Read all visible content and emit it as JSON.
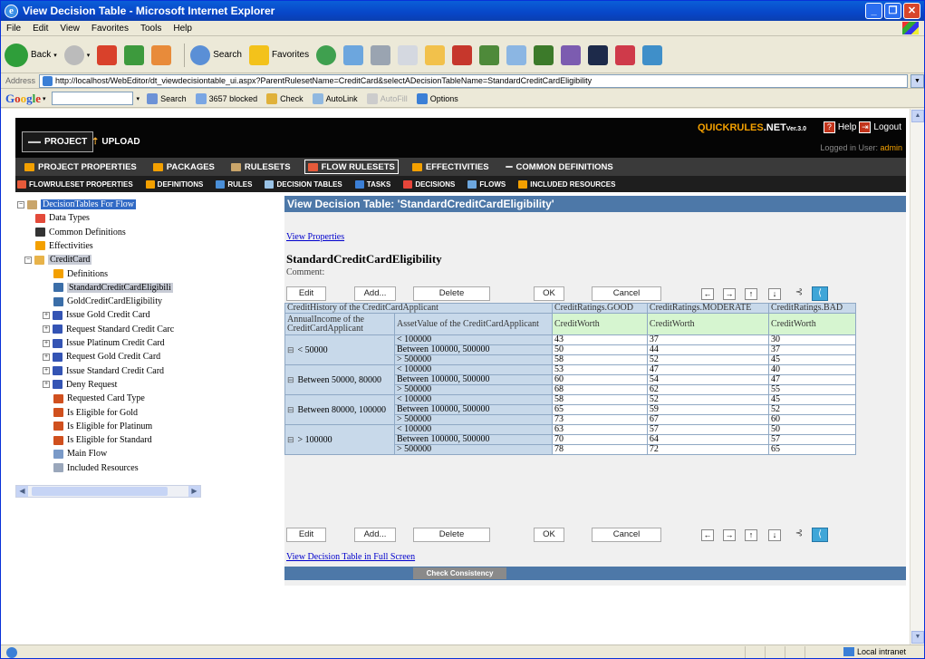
{
  "window": {
    "title": "View Decision Table - Microsoft Internet Explorer"
  },
  "menu": [
    "File",
    "Edit",
    "View",
    "Favorites",
    "Tools",
    "Help"
  ],
  "toolbar": {
    "back": "Back",
    "search": "Search",
    "favorites": "Favorites"
  },
  "address": {
    "label": "Address",
    "url": "http://localhost/WebEditor/dt_viewdecisiontable_ui.aspx?ParentRulesetName=CreditCard&selectADecisionTableName=StandardCreditCardEligibility"
  },
  "google": {
    "logo": "Google",
    "search": "Search",
    "blocked": "3657 blocked",
    "check": "Check",
    "autolink": "AutoLink",
    "autofill": "AutoFill",
    "options": "Options"
  },
  "status": {
    "zone": "Local intranet"
  },
  "app": {
    "project": "PROJECT",
    "upload": "UPLOAD",
    "brand": {
      "quick": "QUICKRULES",
      "net": ".NET",
      "ver": "Ver.3.0"
    },
    "help": "Help",
    "logout": "Logout",
    "logged_in": "Logged in User:",
    "user": "admin",
    "nav1": [
      "PROJECT PROPERTIES",
      "PACKAGES",
      "RULESETS",
      "FLOW RULESETS",
      "EFFECTIVITIES",
      "COMMON DEFINITIONS"
    ],
    "nav2": [
      "FLOWRULESET PROPERTIES",
      "DEFINITIONS",
      "RULES",
      "DECISION TABLES",
      "TASKS",
      "DECISIONS",
      "FLOWS",
      "INCLUDED RESOURCES"
    ]
  },
  "tree": {
    "root": "DecisionTables For Flow",
    "items": [
      "Data Types",
      "Common Definitions",
      "Effectivities",
      "CreditCard",
      "Definitions",
      "StandardCreditCardEligibili",
      "GoldCreditCardEligibility",
      "Issue Gold Credit Card",
      "Request Standard Credit Carc",
      "Issue Platinum Credit Card",
      "Request Gold Credit Card",
      "Issue Standard Credit Card",
      "Deny Request",
      "Requested Card Type",
      "Is Eligible for Gold",
      "Is Eligible for Platinum",
      "Is Eligible for Standard",
      "Main Flow",
      "Included Resources"
    ]
  },
  "main": {
    "header": "View  Decision Table: 'StandardCreditCardEligibility'",
    "view_properties": "View Properties",
    "table_name": "StandardCreditCardEligibility",
    "comment": "Comment:",
    "buttons": {
      "edit": "Edit",
      "add": "Add...",
      "delete": "Delete",
      "ok": "OK",
      "cancel": "Cancel"
    },
    "full_screen": "View Decision Table in Full Screen",
    "check": "Check Consistency"
  },
  "table": {
    "top_left": "CreditHistory of the CreditCardApplicant",
    "col_heads": [
      "CreditRatings.GOOD",
      "CreditRatings.MODERATE",
      "CreditRatings.BAD"
    ],
    "cond1": "AnnualIncome of the CreditCardApplicant",
    "cond2": "AssetValue of the CreditCardApplicant",
    "action": "CreditWorth",
    "groups": [
      {
        "label": "< 50000",
        "rows": [
          [
            "< 100000",
            "43",
            "37",
            "30"
          ],
          [
            "Between 100000, 500000",
            "50",
            "44",
            "37"
          ],
          [
            "> 500000",
            "58",
            "52",
            "45"
          ]
        ]
      },
      {
        "label": "Between 50000, 80000",
        "rows": [
          [
            "< 100000",
            "53",
            "47",
            "40"
          ],
          [
            "Between 100000, 500000",
            "60",
            "54",
            "47"
          ],
          [
            "> 500000",
            "68",
            "62",
            "55"
          ]
        ]
      },
      {
        "label": "Between 80000, 100000",
        "rows": [
          [
            "< 100000",
            "58",
            "52",
            "45"
          ],
          [
            "Between 100000, 500000",
            "65",
            "59",
            "52"
          ],
          [
            "> 500000",
            "73",
            "67",
            "60"
          ]
        ]
      },
      {
        "label": "> 100000",
        "rows": [
          [
            "< 100000",
            "63",
            "57",
            "50"
          ],
          [
            "Between 100000, 500000",
            "70",
            "64",
            "57"
          ],
          [
            "> 500000",
            "78",
            "72",
            "65"
          ]
        ]
      }
    ]
  }
}
